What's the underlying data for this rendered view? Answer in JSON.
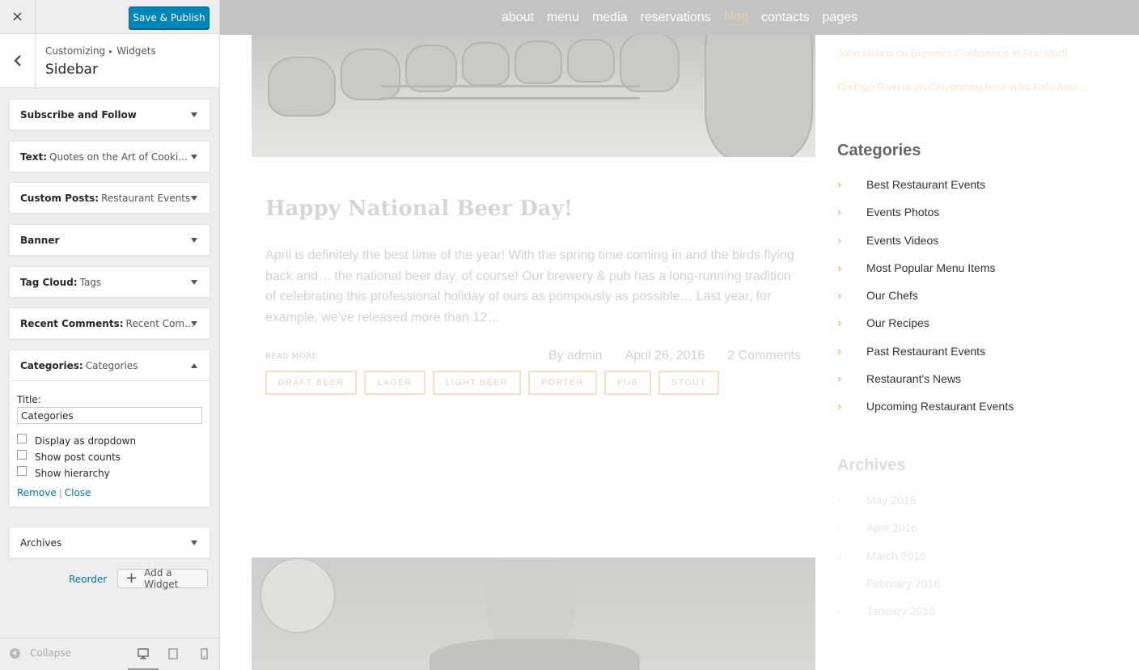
{
  "panel": {
    "close_icon": "×",
    "publish_label": "Save & Publish",
    "breadcrumb_parent": "Customizing",
    "breadcrumb_sep": "▸",
    "breadcrumb_child": "Widgets",
    "section_title": "Sidebar",
    "widgets": [
      {
        "name": "Subscribe and Follow",
        "sub": ""
      },
      {
        "name": "Text:",
        "sub": "Quotes on the Art of Cooki..."
      },
      {
        "name": "Custom Posts:",
        "sub": "Restaurant Events"
      },
      {
        "name": "Banner",
        "sub": ""
      },
      {
        "name": "Tag Cloud:",
        "sub": "Tags"
      },
      {
        "name": "Recent Comments:",
        "sub": "Recent Com..."
      },
      {
        "name": "Categories:",
        "sub": "Categories"
      },
      {
        "name": "Archives",
        "sub": ""
      }
    ],
    "expanded": {
      "title_label": "Title:",
      "title_value": "Categories",
      "options": [
        "Display as dropdown",
        "Show post counts",
        "Show hierarchy"
      ],
      "remove_label": "Remove",
      "separator": "|",
      "close_label": "Close"
    },
    "reorder_label": "Reorder",
    "add_widget_label": "Add a Widget",
    "collapse_label": "Collapse",
    "accent": "#0085ba"
  },
  "preview": {
    "nav": [
      "about",
      "menu",
      "media",
      "reservations",
      "blog",
      "contacts",
      "pages"
    ],
    "active_nav": "blog",
    "post": {
      "title": "Happy National Beer Day!",
      "excerpt": "April is definitely the best time of the year! With the spring time coming in and the birds flying back and… the national beer day, of course! Our brewery & pub has a long-running tradition of celebrating this professional holiday of ours as pompously as possible… Last year, for example, we've released more than 12…",
      "read_more": "READ MORE",
      "author": "By admin",
      "date": "April 26, 2016",
      "comments": "2 Comments",
      "tags": [
        "DRAFT BEER",
        "LAGER",
        "LIGHT BEER",
        "PORTER",
        "PUB",
        "STOUT"
      ]
    },
    "recent_comments": [
      "John Hohns on Brewer's Conference in Frankfort!",
      "Rodrigo Riverra on Celebrating best India Pale Ales..."
    ],
    "categories_title": "Categories",
    "categories": [
      "Best Restaurant Events",
      "Events Photos",
      "Events Videos",
      "Most Popular Menu Items",
      "Our Chefs",
      "Our Recipes",
      "Past Restaurant Events",
      "Restaurant's News",
      "Upcoming Restaurant Events"
    ],
    "archives_title": "Archives",
    "archives": [
      "May 2016",
      "April 2016",
      "March 2016",
      "February 2016",
      "January 2016"
    ]
  }
}
